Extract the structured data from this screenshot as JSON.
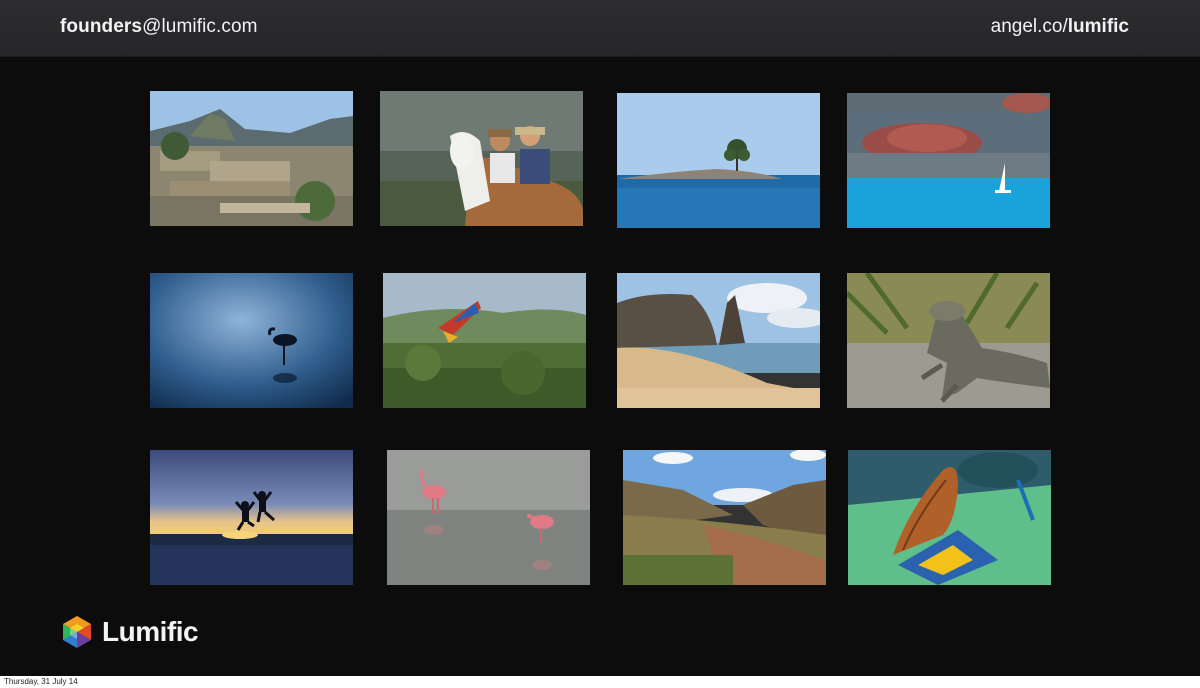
{
  "header": {
    "email_bold": "founders",
    "email_rest": "@lumific.com",
    "angel_rest": "angel.co/",
    "angel_bold": "lumific"
  },
  "gallery": {
    "photos": [
      {
        "subject": "ancient-mountain-ruins"
      },
      {
        "subject": "llama-with-travellers"
      },
      {
        "subject": "islet-with-tree"
      },
      {
        "subject": "red-island-sailboat"
      },
      {
        "subject": "flamingo-silhouette-blue-water"
      },
      {
        "subject": "macaw-over-forest"
      },
      {
        "subject": "rock-spire-beach"
      },
      {
        "subject": "iguana-on-rock"
      },
      {
        "subject": "jumping-silhouettes-sunset"
      },
      {
        "subject": "pink-flamingos-wading"
      },
      {
        "subject": "green-valley-mountains"
      },
      {
        "subject": "orange-butterfly-closeup"
      }
    ]
  },
  "brand": {
    "name": "Lumific",
    "colors": {
      "orange": "#f39a1f",
      "red": "#e04a2b",
      "purple": "#6a3fa0",
      "blue": "#2f7fd0",
      "green": "#2fb55a",
      "yellow": "#f5d02a"
    }
  },
  "footer": {
    "date": "Thursday, 31 July 14"
  }
}
